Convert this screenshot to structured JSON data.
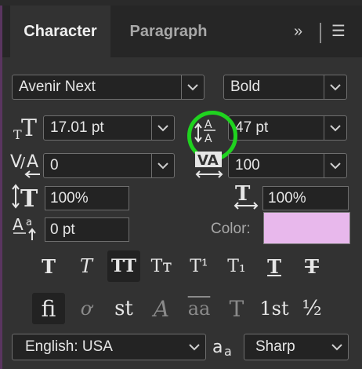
{
  "tabs": {
    "character": "Character",
    "paragraph": "Paragraph"
  },
  "tab_controls": {
    "expand": "»",
    "menu": "☰"
  },
  "font": {
    "family": "Avenir Next",
    "style": "Bold"
  },
  "size": {
    "font_size": "17.01 pt",
    "leading": "47 pt"
  },
  "spacing": {
    "kerning": "0",
    "tracking": "100"
  },
  "scale": {
    "vertical": "100%",
    "horizontal": "100%"
  },
  "baseline": {
    "shift": "0 pt"
  },
  "color": {
    "label": "Color:",
    "value": "#e8b8ec"
  },
  "style_buttons": [
    "T",
    "T",
    "TT",
    "Tт",
    "T¹",
    "T₁",
    "T",
    "T"
  ],
  "opentype_buttons": [
    "ﬁ",
    "ơ",
    "st",
    "A",
    "aa",
    "T",
    "1st",
    "½"
  ],
  "language": {
    "value": "English: USA"
  },
  "antialias": {
    "icon": "aa",
    "value": "Sharp"
  },
  "icons": {
    "font_size": "font-size-icon",
    "leading": "leading-icon",
    "kerning": "kerning-icon",
    "tracking": "tracking-icon",
    "vscale": "vertical-scale-icon",
    "hscale": "horizontal-scale-icon",
    "baseline": "baseline-shift-icon",
    "chevron": "chevron-down-icon"
  }
}
